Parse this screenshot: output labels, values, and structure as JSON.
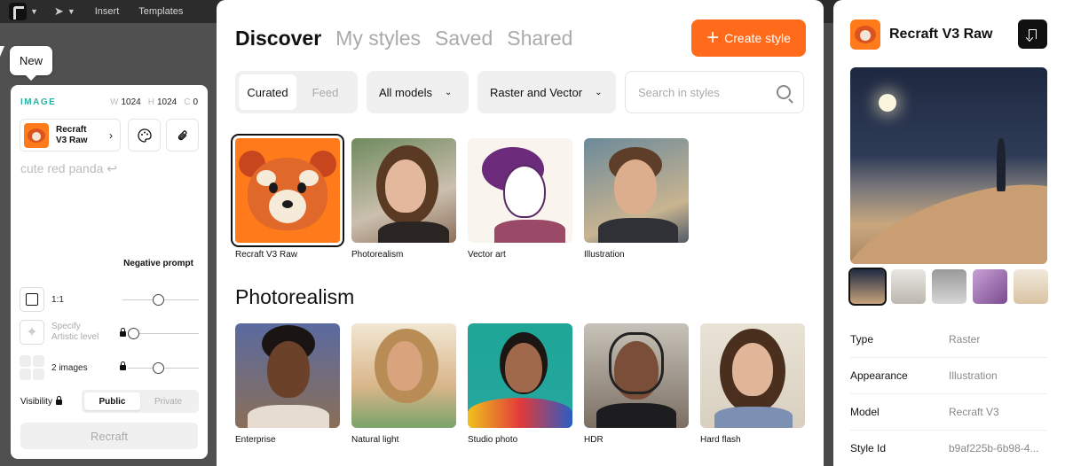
{
  "toolbar": {
    "insert": "Insert",
    "templates": "Templates"
  },
  "tooltip": {
    "new": "New"
  },
  "generator": {
    "title": "IMAGE",
    "width_label": "W",
    "width": "1024",
    "height_label": "H",
    "height": "1024",
    "c_label": "C",
    "c_value": "0",
    "model_line1": "Recraft",
    "model_line2": "V3 Raw",
    "prompt": "cute red panda",
    "negative_prompt": "Negative prompt",
    "aspect": "1:1",
    "artistic_line1": "Specify",
    "artistic_line2": "Artistic level",
    "images": "2 images",
    "visibility": "Visibility",
    "public": "Public",
    "private": "Private",
    "recraft_button": "Recraft"
  },
  "modal": {
    "tabs": [
      {
        "label": "Discover",
        "active": true
      },
      {
        "label": "My styles"
      },
      {
        "label": "Saved"
      },
      {
        "label": "Shared"
      }
    ],
    "create_button": "Create style",
    "filter_curated": "Curated",
    "filter_feed": "Feed",
    "models_dropdown": "All models",
    "type_dropdown": "Raster and Vector",
    "search_placeholder": "Search in styles",
    "featured": [
      "Recraft V3 Raw",
      "Photorealism",
      "Vector art",
      "Illustration"
    ],
    "section_title": "Photorealism",
    "photo_styles": [
      "Enterprise",
      "Natural light",
      "Studio photo",
      "HDR",
      "Hard flash"
    ]
  },
  "detail": {
    "title": "Recraft V3 Raw",
    "props": [
      {
        "key": "Type",
        "value": "Raster"
      },
      {
        "key": "Appearance",
        "value": "Illustration"
      },
      {
        "key": "Model",
        "value": "Recraft V3"
      },
      {
        "key": "Style Id",
        "value": "b9af225b-6b98-4..."
      }
    ]
  },
  "colors": {
    "accent": "#ff6b1a",
    "teal": "#2ab3a4"
  }
}
